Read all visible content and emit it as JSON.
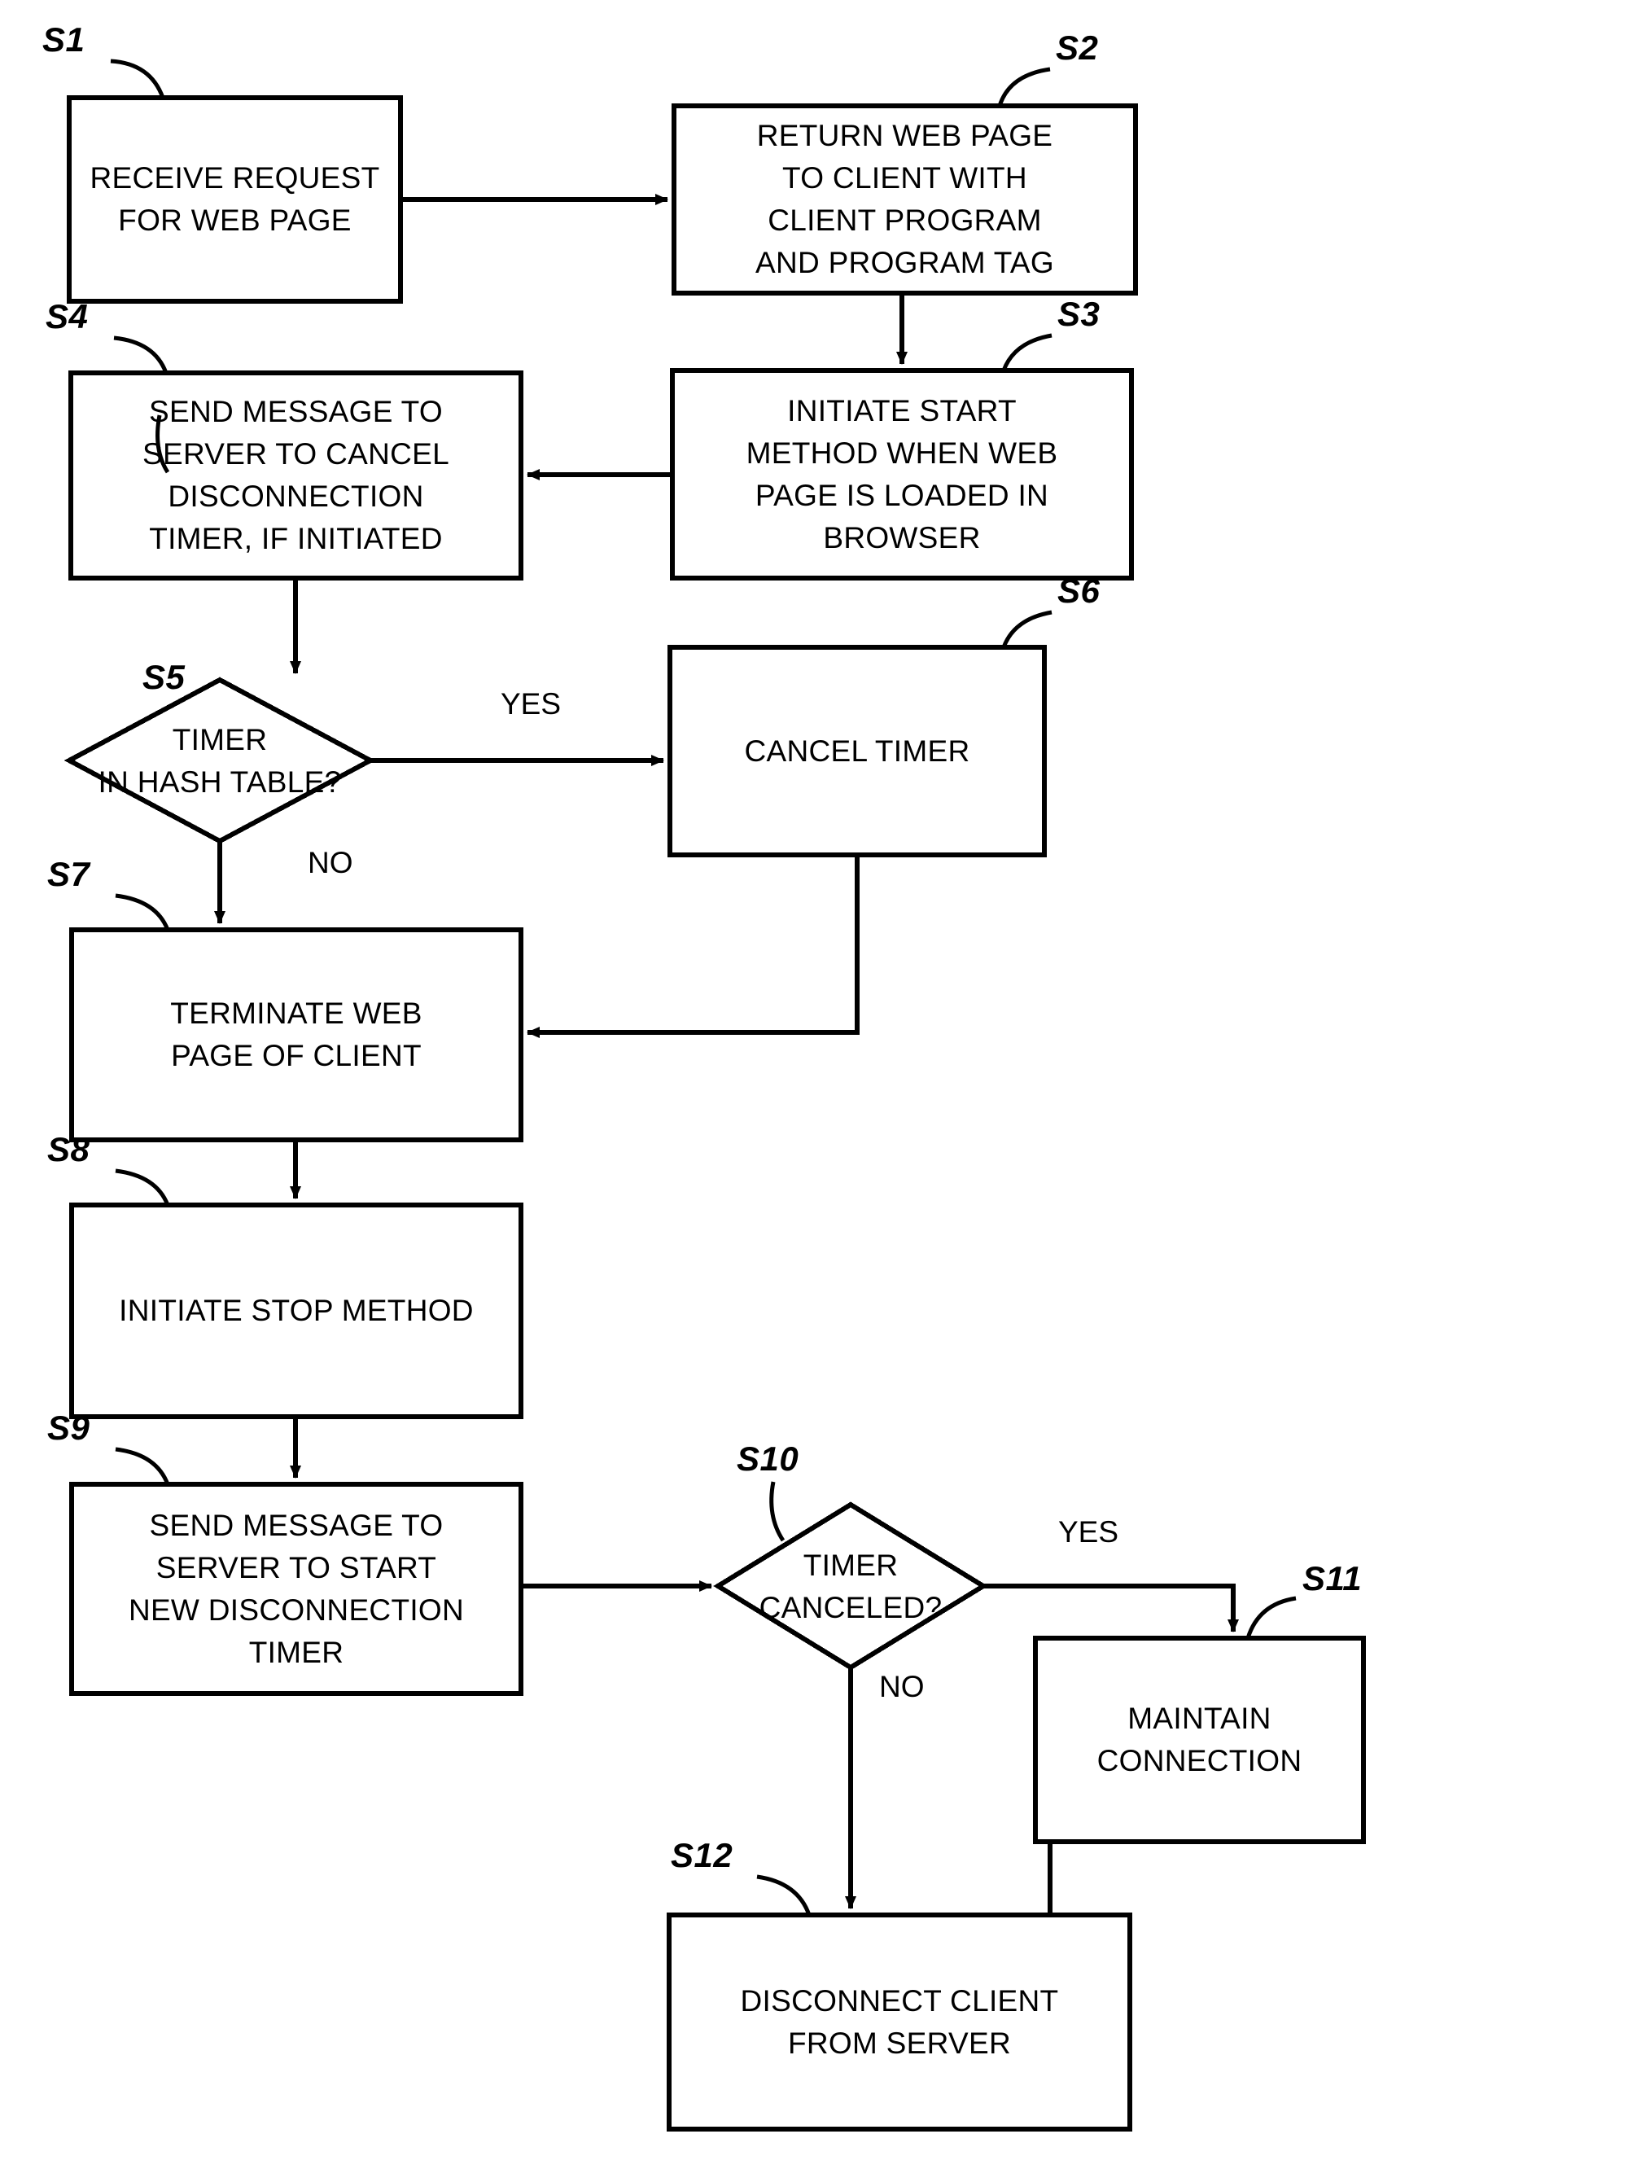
{
  "diagram": {
    "title": "Flowchart of client-server web page connection and disconnection timer process",
    "line_color": "#000000",
    "background_color": "#ffffff",
    "nodes": [
      {
        "id": "S1",
        "tag": "S1",
        "shape": "process",
        "text": "RECEIVE REQUEST\nFOR WEB PAGE"
      },
      {
        "id": "S2",
        "tag": "S2",
        "shape": "process",
        "text": "RETURN WEB PAGE\nTO CLIENT WITH\nCLIENT PROGRAM\nAND PROGRAM TAG"
      },
      {
        "id": "S3",
        "tag": "S3",
        "shape": "process",
        "text": "INITIATE START\nMETHOD WHEN WEB\nPAGE IS LOADED IN\nBROWSER"
      },
      {
        "id": "S4",
        "tag": "S4",
        "shape": "process",
        "text": "SEND MESSAGE TO\nSERVER TO CANCEL\nDISCONNECTION\nTIMER, IF INITIATED"
      },
      {
        "id": "S5",
        "tag": "S5",
        "shape": "decision",
        "text": "TIMER\nIN HASH TABLE?"
      },
      {
        "id": "S6",
        "tag": "S6",
        "shape": "process",
        "text": "CANCEL TIMER"
      },
      {
        "id": "S7",
        "tag": "S7",
        "shape": "process",
        "text": "TERMINATE WEB\nPAGE OF CLIENT"
      },
      {
        "id": "S8",
        "tag": "S8",
        "shape": "process",
        "text": "INITIATE STOP METHOD"
      },
      {
        "id": "S9",
        "tag": "S9",
        "shape": "process",
        "text": "SEND MESSAGE TO\nSERVER TO START\nNEW DISCONNECTION\nTIMER"
      },
      {
        "id": "S10",
        "tag": "S10",
        "shape": "decision",
        "text": "TIMER\nCANCELED?"
      },
      {
        "id": "S11",
        "tag": "S11",
        "shape": "process",
        "text": "MAINTAIN\nCONNECTION"
      },
      {
        "id": "S12",
        "tag": "S12",
        "shape": "process",
        "text": "DISCONNECT CLIENT\nFROM SERVER"
      }
    ],
    "edge_labels": {
      "s5_yes": "YES",
      "s5_no": "NO",
      "s10_yes": "YES",
      "s10_no": "NO"
    }
  }
}
